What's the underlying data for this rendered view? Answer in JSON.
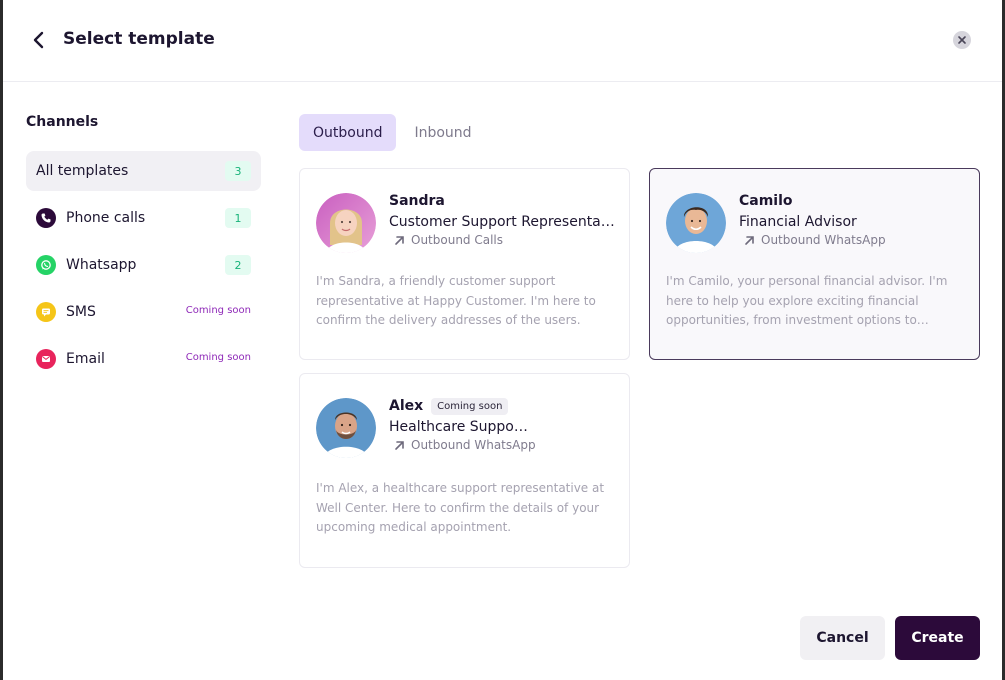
{
  "modal": {
    "title": "Select template"
  },
  "sidebar": {
    "heading": "Channels",
    "items": [
      {
        "label": "All templates",
        "count": "3",
        "icon": "none",
        "active": true
      },
      {
        "label": "Phone calls",
        "count": "1",
        "icon": "phone-icon",
        "color": "#2c0a3a"
      },
      {
        "label": "Whatsapp",
        "count": "2",
        "icon": "whatsapp-icon",
        "color": "#25d366"
      },
      {
        "label": "SMS",
        "status": "Coming soon",
        "icon": "sms-icon",
        "color": "#f5c518"
      },
      {
        "label": "Email",
        "status": "Coming soon",
        "icon": "email-icon",
        "color": "#e8245c"
      }
    ]
  },
  "tabs": [
    {
      "label": "Outbound",
      "active": true
    },
    {
      "label": "Inbound",
      "active": false
    }
  ],
  "cards": [
    {
      "name": "Sandra",
      "role": "Customer Support Representative",
      "channel": "Outbound Calls",
      "description": "I'm Sandra, a friendly customer support representative at Happy Customer. I'm here to confirm the delivery addresses of the users."
    },
    {
      "name": "Camilo",
      "role": "Financial Advisor",
      "channel": "Outbound WhatsApp",
      "description": "I'm Camilo, your personal financial advisor. I'm here to help you explore exciting financial opportunities, from investment options to retirement planning.",
      "selected": true
    },
    {
      "name": "Alex",
      "badge": "Coming soon",
      "role": "Healthcare Support Representative",
      "channel": "Outbound WhatsApp",
      "description": "I'm Alex, a healthcare support representative at Well Center. Here to confirm the details of your upcoming medical appointment."
    }
  ],
  "footer": {
    "cancel_label": "Cancel",
    "create_label": "Create"
  },
  "colors": {
    "brand_dark": "#2c0a3a",
    "tab_active_bg": "#e4dcfb",
    "count_badge_bg": "#e3fbf1",
    "count_badge_text": "#19b37a",
    "coming_soon_text": "#8f2ab8"
  }
}
